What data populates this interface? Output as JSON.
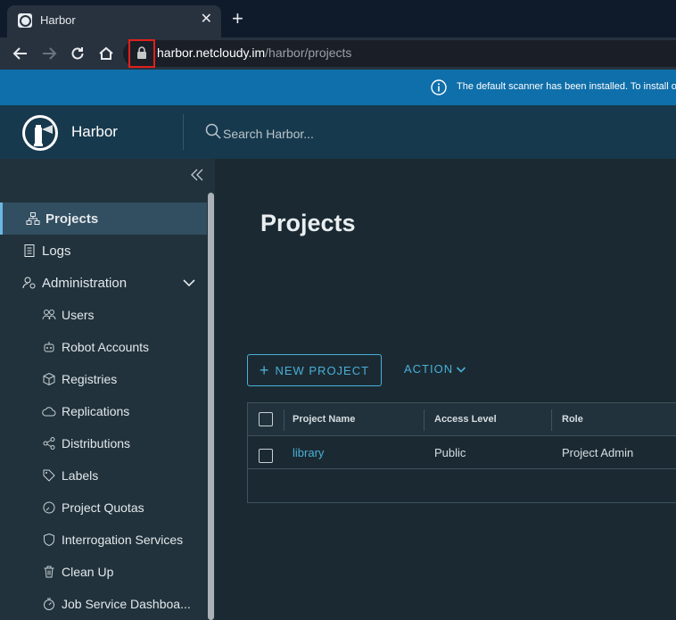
{
  "browser": {
    "tab_title": "Harbor",
    "tab_close": "✕",
    "new_tab": "+",
    "url_host": "harbor.netcloudy.im",
    "url_path": "/harbor/projects"
  },
  "banner": {
    "text": "The default scanner has been installed. To install ot"
  },
  "header": {
    "brand": "Harbor",
    "search_placeholder": "Search Harbor..."
  },
  "sidebar": {
    "items": [
      {
        "label": "Projects",
        "icon": "projects-icon"
      },
      {
        "label": "Logs",
        "icon": "logs-icon"
      },
      {
        "label": "Administration",
        "icon": "administration-icon"
      }
    ],
    "admin_items": [
      {
        "label": "Users",
        "icon": "users-icon"
      },
      {
        "label": "Robot Accounts",
        "icon": "robot-icon"
      },
      {
        "label": "Registries",
        "icon": "registries-icon"
      },
      {
        "label": "Replications",
        "icon": "replications-icon"
      },
      {
        "label": "Distributions",
        "icon": "distributions-icon"
      },
      {
        "label": "Labels",
        "icon": "labels-icon"
      },
      {
        "label": "Project Quotas",
        "icon": "quotas-icon"
      },
      {
        "label": "Interrogation Services",
        "icon": "interrogation-icon"
      },
      {
        "label": "Clean Up",
        "icon": "trash-icon"
      },
      {
        "label": "Job Service Dashboa...",
        "icon": "job-service-icon"
      }
    ]
  },
  "main": {
    "title": "Projects",
    "new_project_label": "NEW PROJECT",
    "action_label": "ACTION",
    "columns": [
      "Project Name",
      "Access Level",
      "Role"
    ],
    "rows": [
      {
        "name": "library",
        "access": "Public",
        "role": "Project Admin"
      }
    ]
  },
  "colors": {
    "accent": "#49afd9",
    "banner": "#0f6faa",
    "header": "#17394d",
    "sidebar": "#21323c",
    "content": "#1b2a32"
  }
}
